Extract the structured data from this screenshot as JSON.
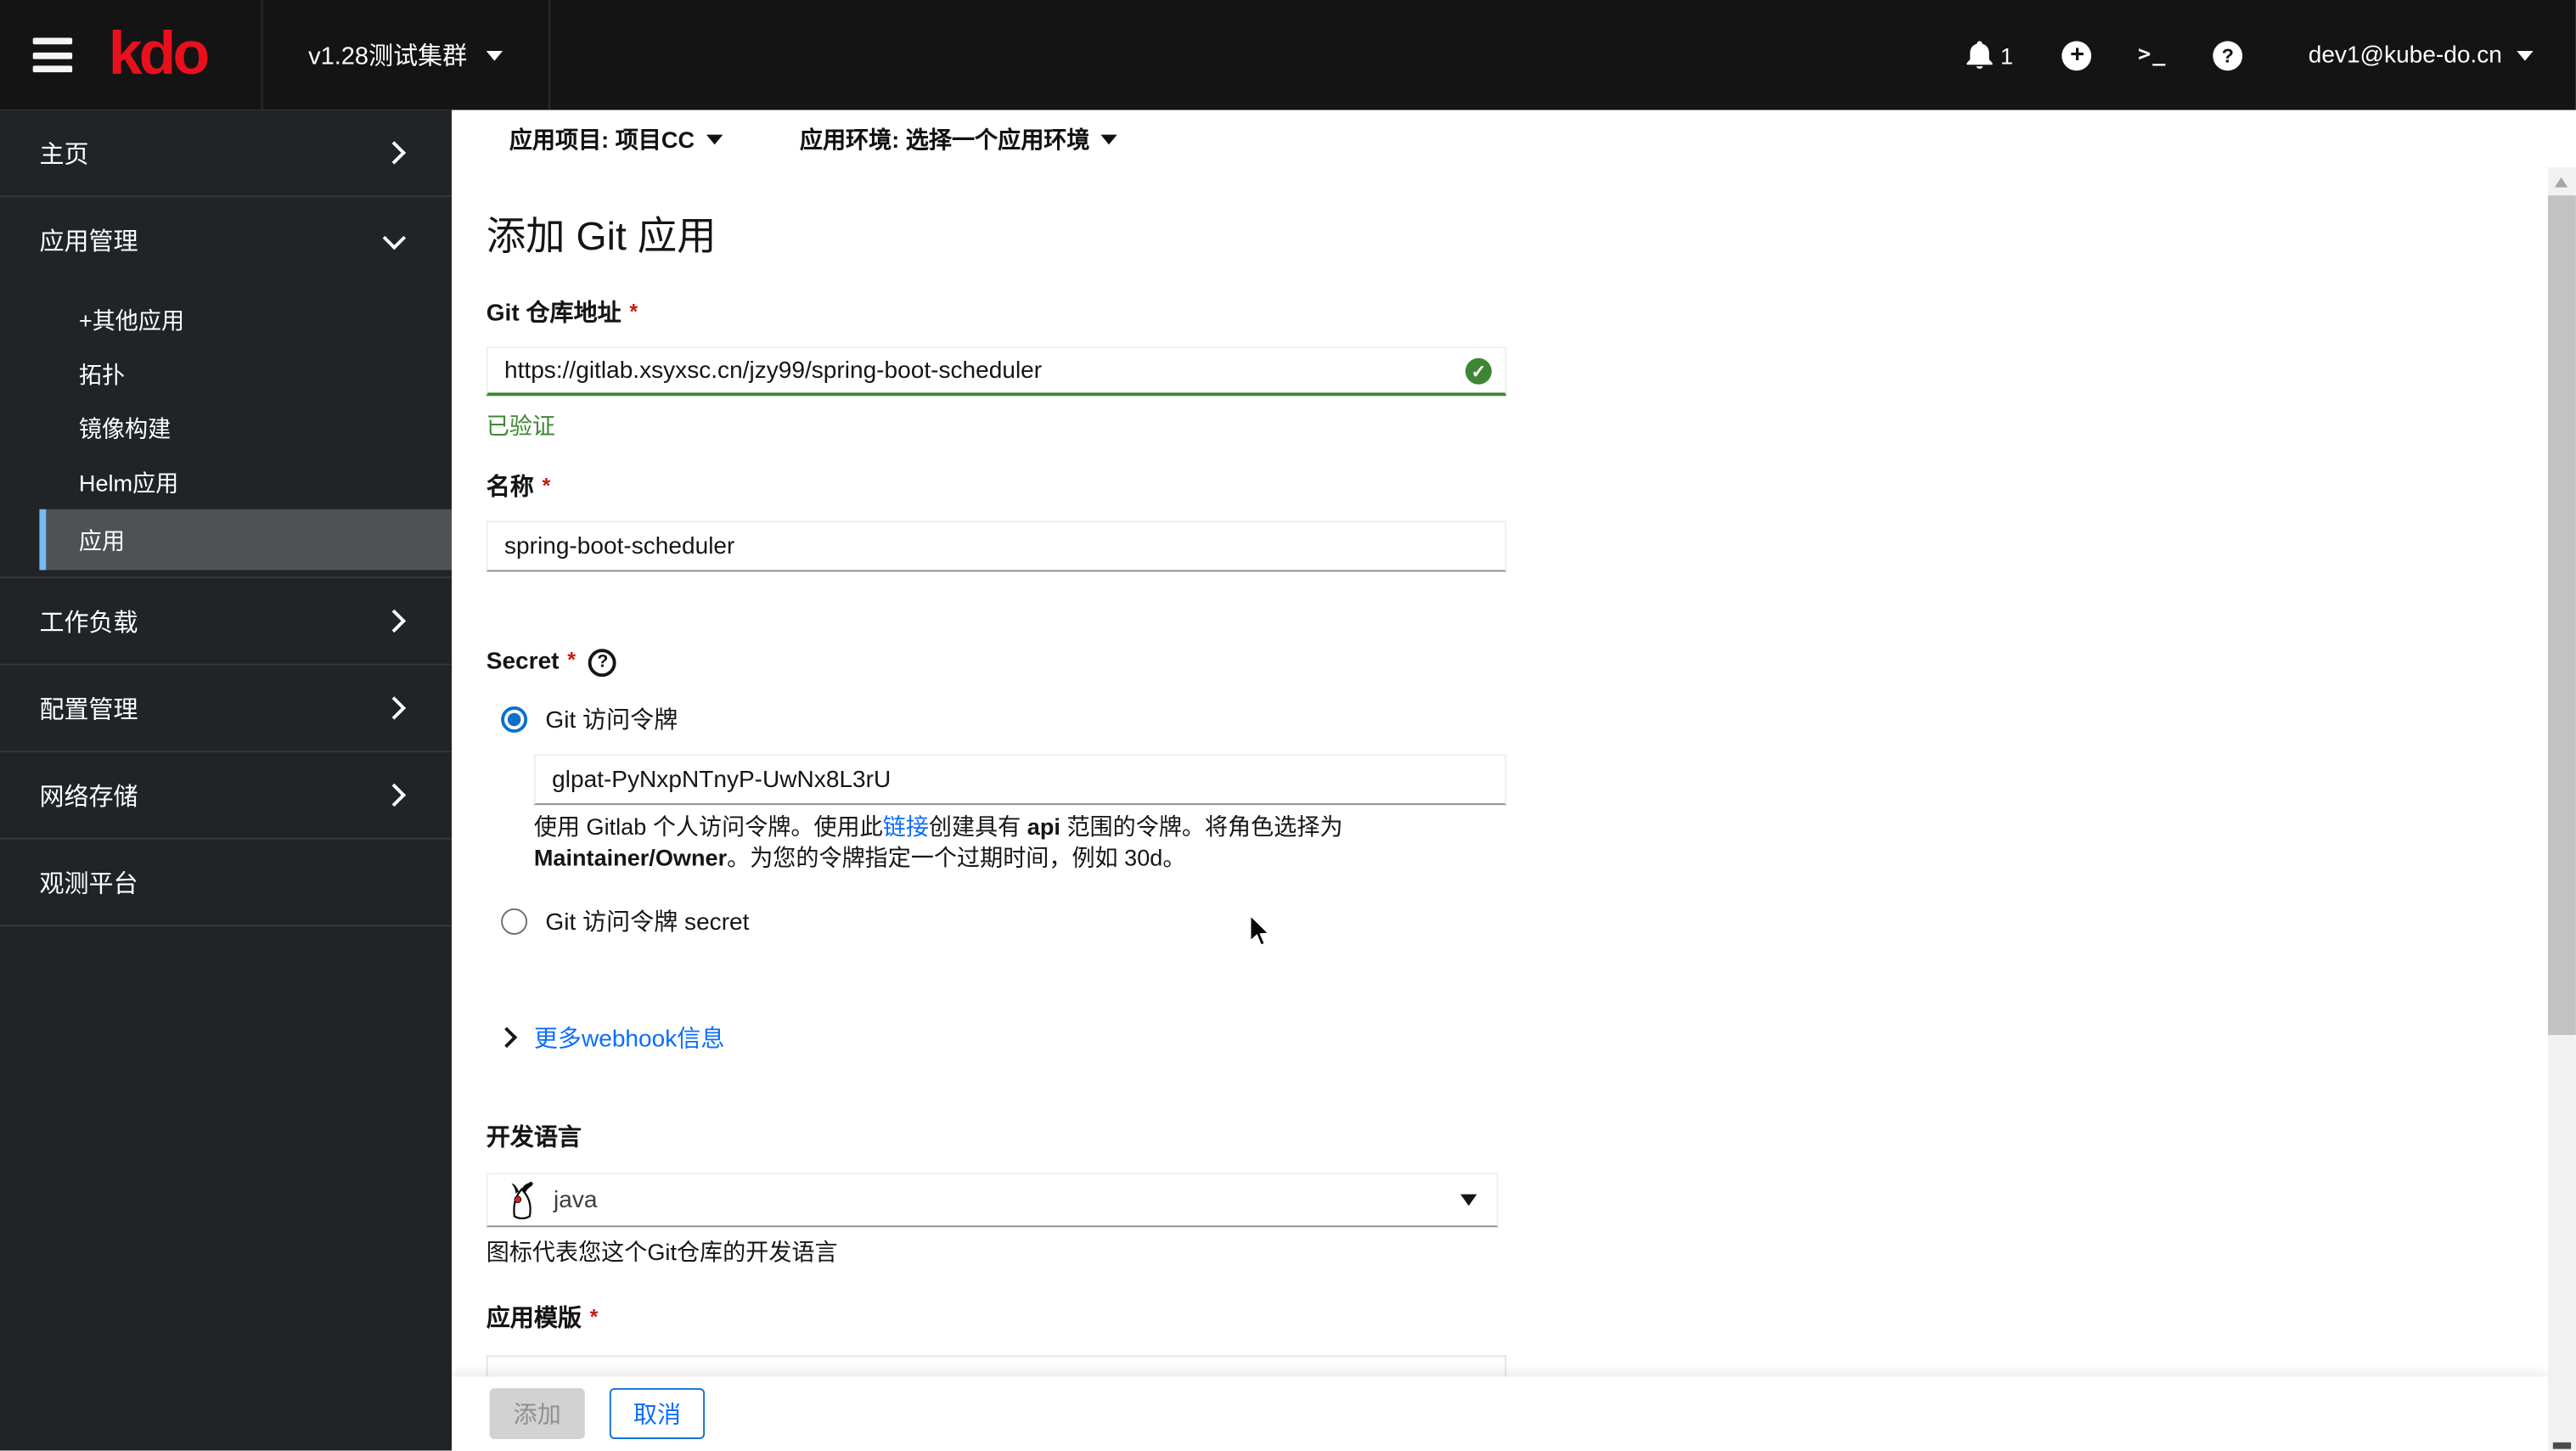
{
  "topbar": {
    "logo": "kdo",
    "cluster": "v1.28测试集群",
    "notifications": "1",
    "user": "dev1@kube-do.cn"
  },
  "icons": {
    "terminal_glyph": ">_",
    "plus_glyph": "+",
    "question_glyph": "?",
    "check_glyph": "✓"
  },
  "sidebar": {
    "items": [
      {
        "label": "主页"
      },
      {
        "label": "应用管理",
        "children": [
          {
            "label": "+其他应用"
          },
          {
            "label": "拓扑"
          },
          {
            "label": "镜像构建"
          },
          {
            "label": "Helm应用"
          },
          {
            "label": "应用",
            "active": true
          }
        ]
      },
      {
        "label": "工作负载"
      },
      {
        "label": "配置管理"
      },
      {
        "label": "网络存储"
      },
      {
        "label": "观测平台"
      }
    ]
  },
  "context_bar": {
    "project": "应用项目: 项目CC",
    "environment": "应用环境: 选择一个应用环境"
  },
  "form": {
    "title": "添加 Git 应用",
    "required_marker": "*",
    "fields": {
      "git_repo": {
        "label": "Git 仓库地址",
        "value": "https://gitlab.xsyxsc.cn/jzy99/spring-boot-scheduler",
        "status": "已验证"
      },
      "name": {
        "label": "名称",
        "value": "spring-boot-scheduler"
      },
      "secret": {
        "label": "Secret",
        "options": [
          {
            "label": "Git 访问令牌",
            "selected": true
          },
          {
            "label": "Git 访问令牌 secret",
            "selected": false
          }
        ],
        "token_value": "glpat-PyNxpNTnyP-UwNx8L3rU",
        "help": {
          "part1": "使用 Gitlab 个人访问令牌。使用此",
          "link": "链接",
          "part2": "创建具有 ",
          "bold1": "api",
          "part3": " 范围的令牌。将角色选择为 ",
          "bold2": "Maintainer/Owner",
          "part4": "。为您的令牌指定一个过期时间，例如 30d。"
        }
      },
      "webhook_toggle": "更多webhook信息",
      "language": {
        "label": "开发语言",
        "value": "java",
        "help": "图标代表您这个Git仓库的开发语言"
      },
      "template": {
        "label": "应用模版"
      }
    },
    "actions": {
      "add": "添加",
      "cancel": "取消"
    }
  },
  "colors": {
    "brand_red": "#e8101c",
    "accent_blue": "#73bcf7",
    "link_blue": "#0a6cff",
    "success_green": "#3e8635",
    "danger_red": "#c9190b"
  }
}
